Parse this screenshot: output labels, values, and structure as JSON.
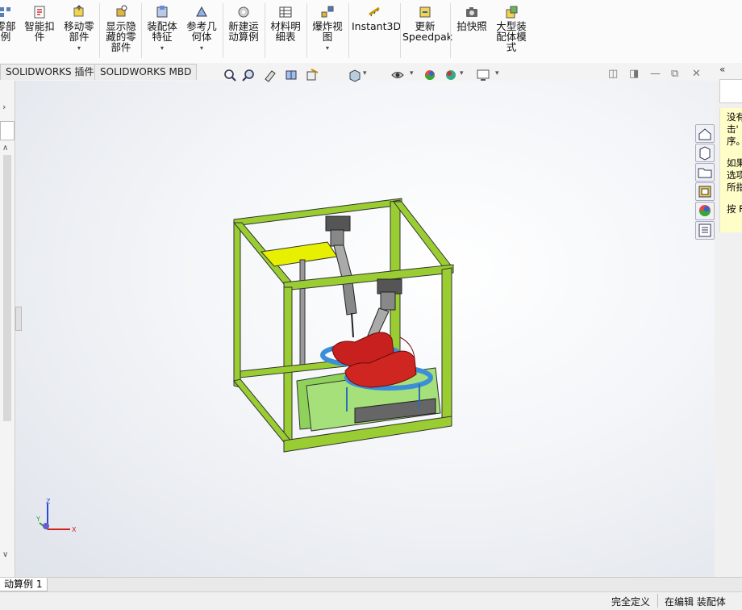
{
  "ribbon": {
    "items": [
      {
        "label": "零部\n例",
        "icon": "pattern-icon"
      },
      {
        "label": "智能扣\n件",
        "icon": "smart-fastener-icon"
      },
      {
        "label": "移动零\n部件",
        "icon": "move-component-icon",
        "dropdown": "▾"
      },
      {
        "label": "显示隐\n藏的零\n部件",
        "icon": "show-hidden-icon"
      },
      {
        "label": "装配体\n特征",
        "icon": "assembly-feature-icon",
        "dropdown": "▾"
      },
      {
        "label": "参考几\n何体",
        "icon": "reference-geometry-icon",
        "dropdown": "▾"
      },
      {
        "label": "新建运\n动算例",
        "icon": "new-motion-study-icon"
      },
      {
        "label": "材料明\n细表",
        "icon": "bom-icon"
      },
      {
        "label": "爆炸视\n图",
        "icon": "exploded-view-icon",
        "dropdown": "▾"
      },
      {
        "label": "Instant3D",
        "icon": "instant3d-icon"
      },
      {
        "label": "更新\nSpeedpak",
        "icon": "speedpak-icon"
      },
      {
        "label": "拍快照",
        "icon": "snapshot-icon"
      },
      {
        "label": "大型装\n配体模\n式",
        "icon": "large-assembly-icon"
      }
    ]
  },
  "tabs": [
    {
      "label": "SOLIDWORKS 插件"
    },
    {
      "label": "SOLIDWORKS MBD"
    }
  ],
  "tip": {
    "lines": [
      "没有",
      "击'",
      "序。",
      "",
      "如果",
      "选项",
      "所指",
      "",
      "按 F"
    ]
  },
  "sheet_tab": "动算例 1",
  "status": {
    "defined": "完全定义",
    "editing": "在编辑 装配体"
  },
  "triad": {
    "x": "X",
    "y": "Y",
    "z": "Z"
  },
  "colors": {
    "frame": "#9acd32",
    "shoe": "#c8201e",
    "plate": "#e6f000",
    "base": "#8ed25a",
    "ring": "#3a8fd8"
  }
}
